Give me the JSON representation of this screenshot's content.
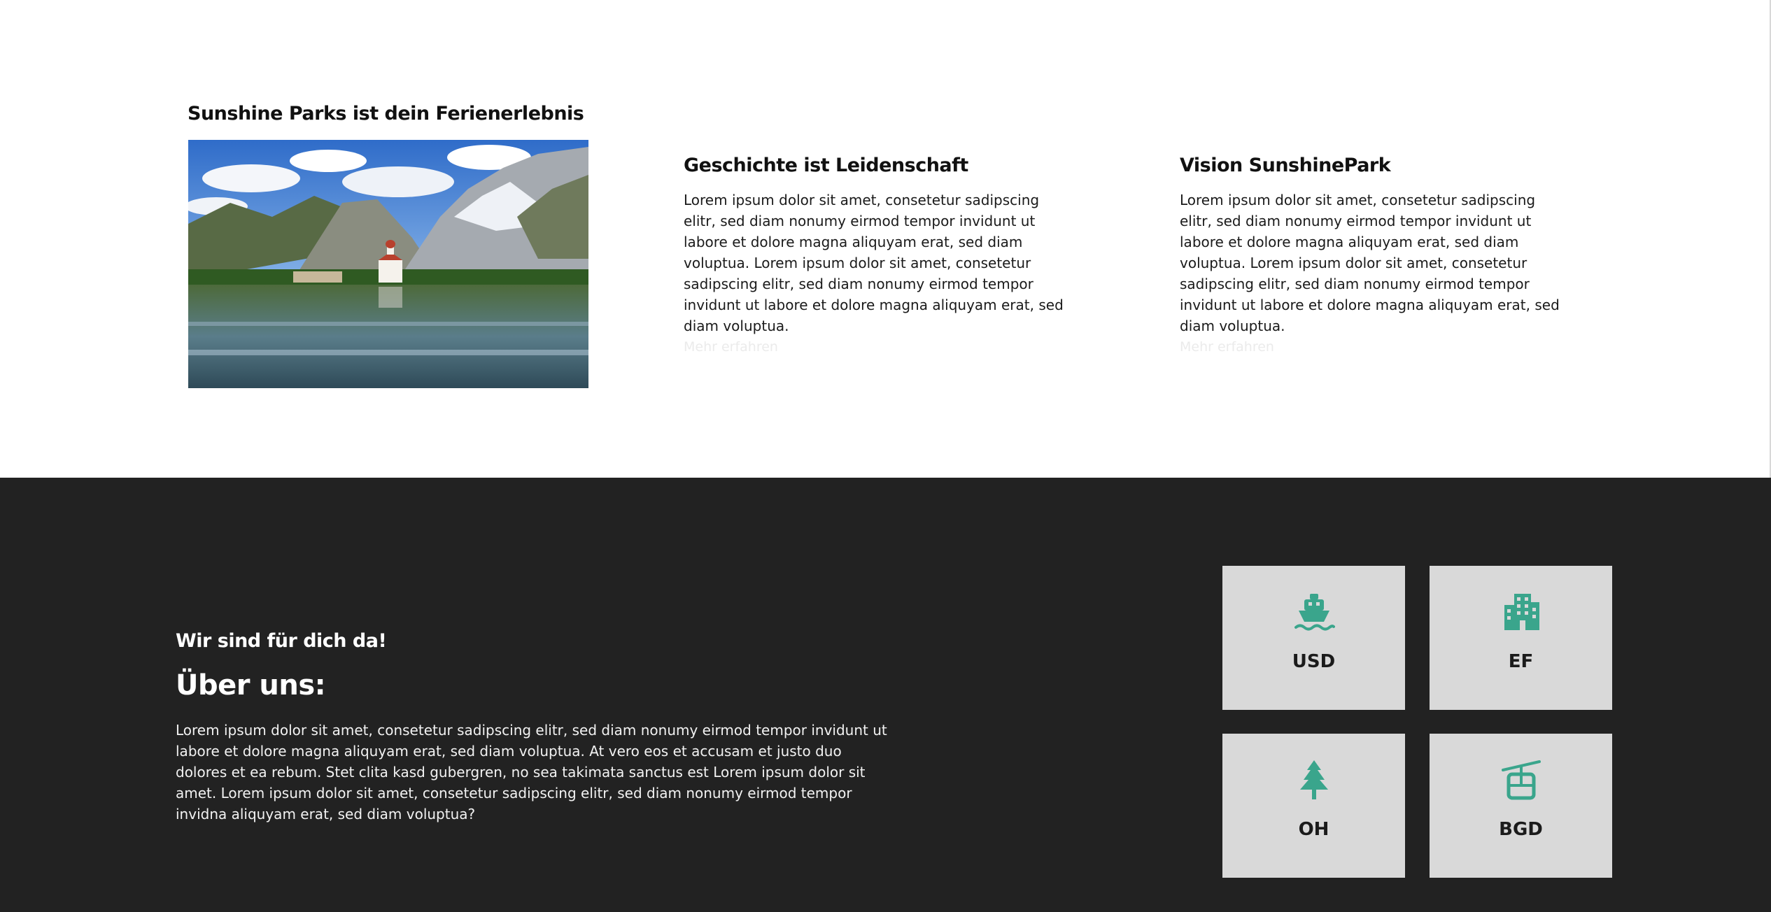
{
  "intro": {
    "title": "Sunshine Parks ist dein Ferienerlebnis",
    "image_alt": "Bergsee mit Kirche"
  },
  "columns": [
    {
      "heading": "Geschichte ist Leidenschaft",
      "body": "Lorem ipsum dolor sit amet, consetetur sadipscing elitr, sed diam nonumy eirmod tempor invidunt ut labore et dolore magna aliquyam erat, sed diam voluptua. Lorem ipsum dolor sit amet, consetetur sadipscing elitr, sed diam nonumy eirmod tempor invidunt ut labore et dolore magna aliquyam erat, sed diam voluptua.",
      "link": "Mehr erfahren"
    },
    {
      "heading": "Vision SunshinePark",
      "body": "Lorem ipsum dolor sit amet, consetetur sadipscing elitr, sed diam nonumy eirmod tempor invidunt ut labore et dolore magna aliquyam erat, sed diam voluptua. Lorem ipsum dolor sit amet, consetetur sadipscing elitr, sed diam nonumy eirmod tempor invidunt ut labore et dolore magna aliquyam erat, sed diam voluptua.",
      "link": "Mehr erfahren"
    }
  ],
  "about": {
    "kicker": "Wir sind für dich da!",
    "title": "Über uns:",
    "body": "Lorem ipsum dolor sit amet, consetetur sadipscing elitr, sed diam nonumy eirmod tempor invidunt ut labore et dolore magna aliquyam erat, sed diam voluptua. At vero eos et accusam et justo duo dolores et ea rebum. Stet clita kasd gubergren, no sea takimata sanctus est Lorem ipsum dolor sit amet. Lorem ipsum dolor sit amet, consetetur sadipscing elitr, sed diam nonumy eirmod tempor invidna aliquyam erat, sed diam voluptua?"
  },
  "tiles": [
    {
      "code": "USD",
      "icon": "ship-icon"
    },
    {
      "code": "EF",
      "icon": "building-icon"
    },
    {
      "code": "OH",
      "icon": "tree-icon"
    },
    {
      "code": "BGD",
      "icon": "cable-car-icon"
    }
  ],
  "colors": {
    "accent": "#3aa58c",
    "dark_bg": "#222222",
    "tile_bg": "#d9d9d9"
  }
}
